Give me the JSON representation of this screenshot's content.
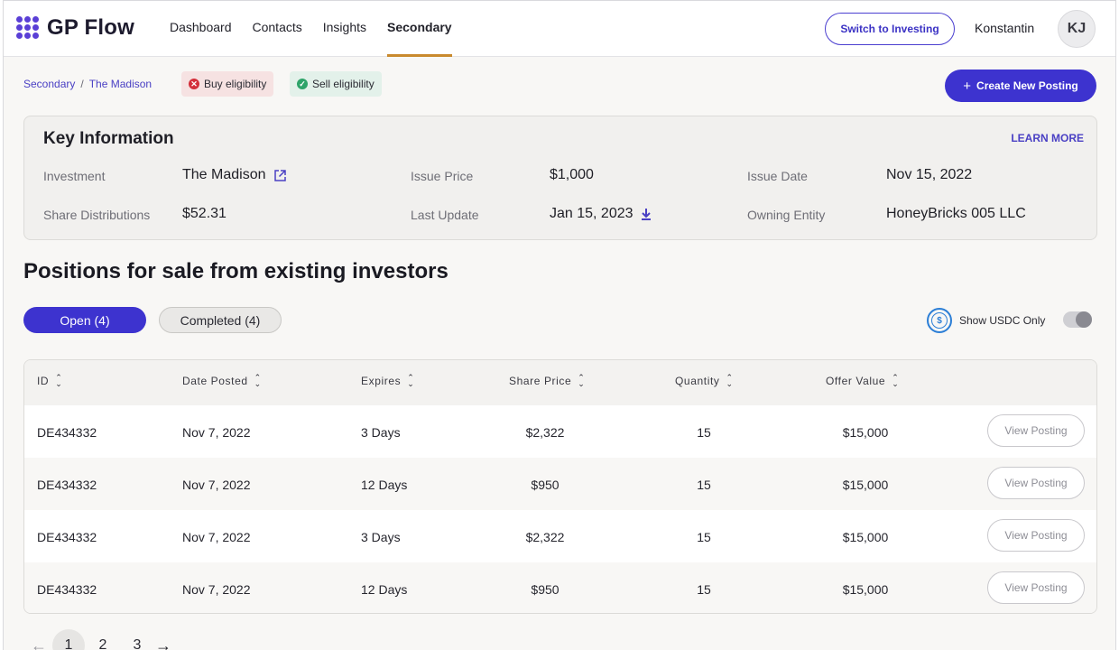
{
  "app": {
    "name": "GP Flow",
    "brand_color": "#3d33cf"
  },
  "nav": {
    "items": [
      {
        "label": "Dashboard"
      },
      {
        "label": "Contacts"
      },
      {
        "label": "Insights"
      },
      {
        "label": "Secondary",
        "active": true
      }
    ]
  },
  "header": {
    "switch_label": "Switch to Investing",
    "user_name": "Konstantin",
    "avatar_initials": "KJ"
  },
  "breadcrumb": {
    "root": "Secondary",
    "separator": "/",
    "current": "The Madison"
  },
  "eligibility": {
    "buy_label": "Buy eligibility",
    "buy_icon": "x-circle-icon",
    "sell_label": "Sell eligibility",
    "sell_icon": "check-circle-icon"
  },
  "create_button": {
    "icon": "+",
    "label": "Create New Posting"
  },
  "key_info": {
    "title": "Key Information",
    "learn_more": "LEARN MORE",
    "fields": [
      {
        "label": "Investment",
        "value": "The Madison",
        "icon": "external-link-icon"
      },
      {
        "label": "Issue Price",
        "value": "$1,000"
      },
      {
        "label": "Issue Date",
        "value": "Nov 15, 2022"
      },
      {
        "label": "Share Distributions",
        "value": "$52.31"
      },
      {
        "label": "Last Update",
        "value": "Jan 15, 2023",
        "icon": "download-icon"
      },
      {
        "label": "Owning Entity",
        "value": "HoneyBricks 005 LLC"
      }
    ]
  },
  "positions": {
    "title": "Positions for sale from existing investors",
    "tabs": [
      {
        "label": "Open (4)",
        "active": true
      },
      {
        "label": "Completed (4)",
        "active": false
      }
    ],
    "usdc_label": "Show USDC Only",
    "usdc_icon_symbol": "$",
    "usdc_toggle_on": false
  },
  "table": {
    "columns": [
      "ID",
      "Date Posted",
      "Expires",
      "Share Price",
      "Quantity",
      "Offer Value"
    ],
    "rows": [
      {
        "id": "DE434332",
        "date_posted": "Nov 7, 2022",
        "expires": "3 Days",
        "share_price": "$2,322",
        "quantity": "15",
        "offer_value": "$15,000",
        "action": "View Posting"
      },
      {
        "id": "DE434332",
        "date_posted": "Nov 7, 2022",
        "expires": "12 Days",
        "share_price": "$950",
        "quantity": "15",
        "offer_value": "$15,000",
        "action": "View Posting"
      },
      {
        "id": "DE434332",
        "date_posted": "Nov 7, 2022",
        "expires": "3 Days",
        "share_price": "$2,322",
        "quantity": "15",
        "offer_value": "$15,000",
        "action": "View Posting"
      },
      {
        "id": "DE434332",
        "date_posted": "Nov 7, 2022",
        "expires": "12 Days",
        "share_price": "$950",
        "quantity": "15",
        "offer_value": "$15,000",
        "action": "View Posting"
      }
    ]
  },
  "pagination": {
    "pages": [
      "1",
      "2",
      "3"
    ],
    "current": "1"
  }
}
